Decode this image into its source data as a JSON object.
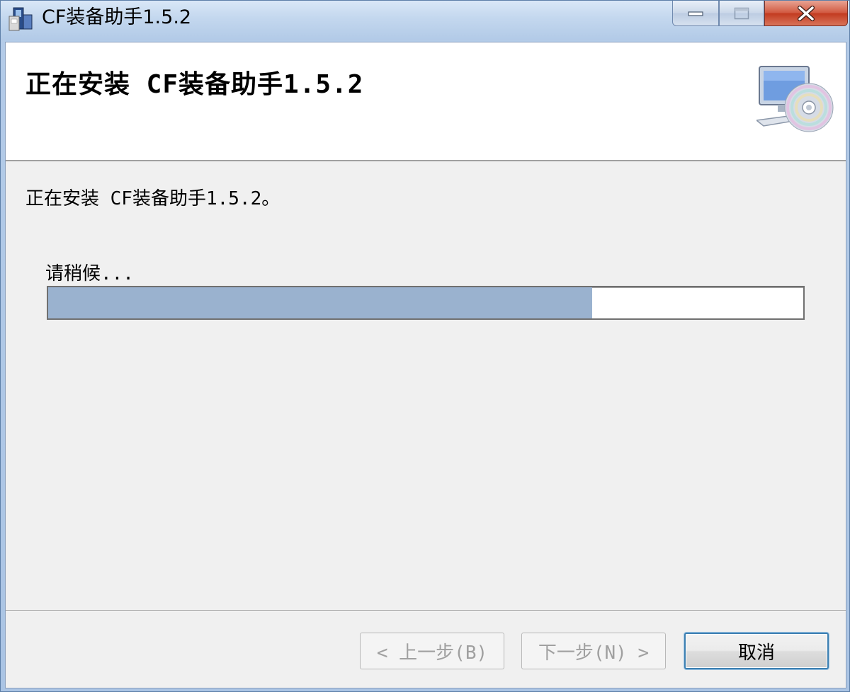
{
  "window": {
    "title": "CF装备助手1.5.2"
  },
  "caption_buttons": {
    "minimize_icon": "minimize-icon",
    "maximize_icon": "maximize-icon",
    "close_icon": "close-icon"
  },
  "header": {
    "title": "正在安装 CF装备助手1.5.2",
    "icon": "computer-cd-icon"
  },
  "body": {
    "status": "正在安装 CF装备助手1.5.2。",
    "wait_label": "请稍候...",
    "progress_fraction": 0.72
  },
  "footer": {
    "back_label": "< 上一步(B)",
    "next_label": "下一步(N) >",
    "cancel_label": "取消"
  },
  "colors": {
    "progress_fill": "#9ab2cf",
    "client_bg": "#f0f0f0",
    "header_bg": "#ffffff",
    "close_button": "#c23a1f"
  }
}
